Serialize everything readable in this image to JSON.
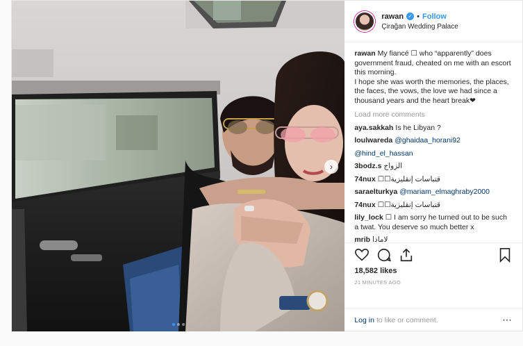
{
  "header": {
    "username": "rawan",
    "separator": "•",
    "follow_label": "Follow",
    "location": "Çirağan Wedding Palace"
  },
  "media": {
    "next_arrow_icon": "chevron-right-icon",
    "slide_count": 3,
    "active_slide": 1
  },
  "caption": {
    "username": "rawan",
    "text": "My fiancé ☐ who “apparently” does government fraud, cheated on me with an escort this morning.",
    "text2": "I hope she was worth the memories, the places, the faces, the vows, the love we had since a thousand years and the heart break❤"
  },
  "load_more_label": "Load more comments",
  "comments": [
    {
      "user": "aya.sakkah",
      "parts": [
        {
          "t": "Is he Libyan ?",
          "m": false
        }
      ]
    },
    {
      "user": "loulwareda",
      "parts": [
        {
          "t": "@ghaidaa_horani92",
          "m": true
        }
      ]
    },
    {
      "user": "",
      "parts": [
        {
          "t": "@hind_el_hassan",
          "m": true
        }
      ]
    },
    {
      "user": "3bodz.s",
      "parts": [
        {
          "t": "الزواج",
          "m": false
        }
      ]
    },
    {
      "user": "74nux",
      "parts": [
        {
          "t": "☐☐قتباسات إنقليزية",
          "m": false
        }
      ]
    },
    {
      "user": "saraelturkya",
      "parts": [
        {
          "t": "@mariam_elmaghraby2000",
          "m": true
        }
      ]
    },
    {
      "user": "74nux",
      "parts": [
        {
          "t": "☐☐قتباسات إنقليزية",
          "m": false
        }
      ]
    },
    {
      "user": "lily_lock",
      "parts": [
        {
          "t": "☐ I am sorry he turned out to be such a twat. You deserve so much better x",
          "m": false
        }
      ],
      "wrap": true
    },
    {
      "user": "mrib",
      "parts": [
        {
          "t": "لاماذا",
          "m": false
        }
      ]
    }
  ],
  "actions": {
    "like_icon": "heart-icon",
    "comment_icon": "comment-icon",
    "share_icon": "share-icon",
    "save_icon": "bookmark-icon",
    "likes_count": "18,582",
    "likes_label": "likes",
    "timestamp": "21 MINUTES AGO"
  },
  "footer": {
    "login_label": "Log in",
    "rest_label": "to like or comment.",
    "more_icon": "more-options-icon"
  },
  "colors": {
    "accent": "#3897f0",
    "text": "#262626",
    "muted": "#999999",
    "link": "#003569"
  }
}
